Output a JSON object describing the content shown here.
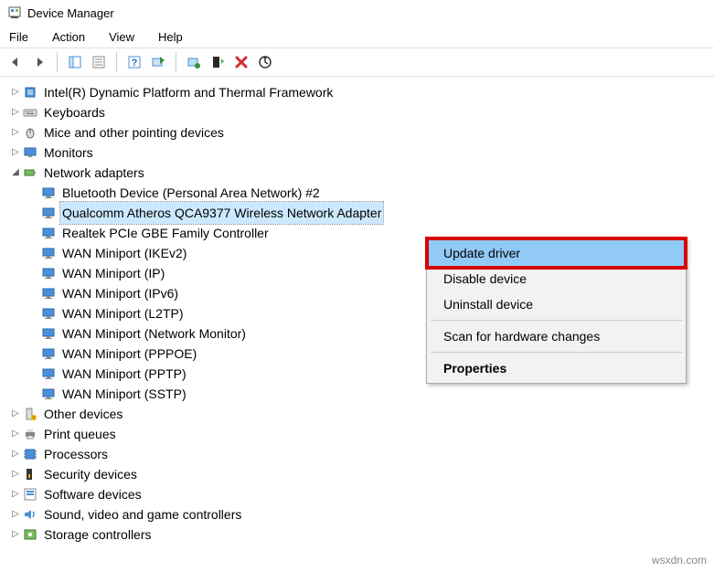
{
  "window": {
    "title": "Device Manager"
  },
  "menu": {
    "file": "File",
    "action": "Action",
    "view": "View",
    "help": "Help"
  },
  "tree": {
    "intel": "Intel(R) Dynamic Platform and Thermal Framework",
    "keyboards": "Keyboards",
    "mice": "Mice and other pointing devices",
    "monitors": "Monitors",
    "network": "Network adapters",
    "net_children": [
      "Bluetooth Device (Personal Area Network) #2",
      "Qualcomm Atheros QCA9377 Wireless Network Adapter",
      "Realtek PCIe GBE Family Controller",
      "WAN Miniport (IKEv2)",
      "WAN Miniport (IP)",
      "WAN Miniport (IPv6)",
      "WAN Miniport (L2TP)",
      "WAN Miniport (Network Monitor)",
      "WAN Miniport (PPPOE)",
      "WAN Miniport (PPTP)",
      "WAN Miniport (SSTP)"
    ],
    "other": "Other devices",
    "print": "Print queues",
    "processors": "Processors",
    "security": "Security devices",
    "software": "Software devices",
    "sound": "Sound, video and game controllers",
    "storage": "Storage controllers"
  },
  "ctx": {
    "update": "Update driver",
    "disable": "Disable device",
    "uninstall": "Uninstall device",
    "scan": "Scan for hardware changes",
    "properties": "Properties"
  },
  "watermark": "wsxdn.com"
}
